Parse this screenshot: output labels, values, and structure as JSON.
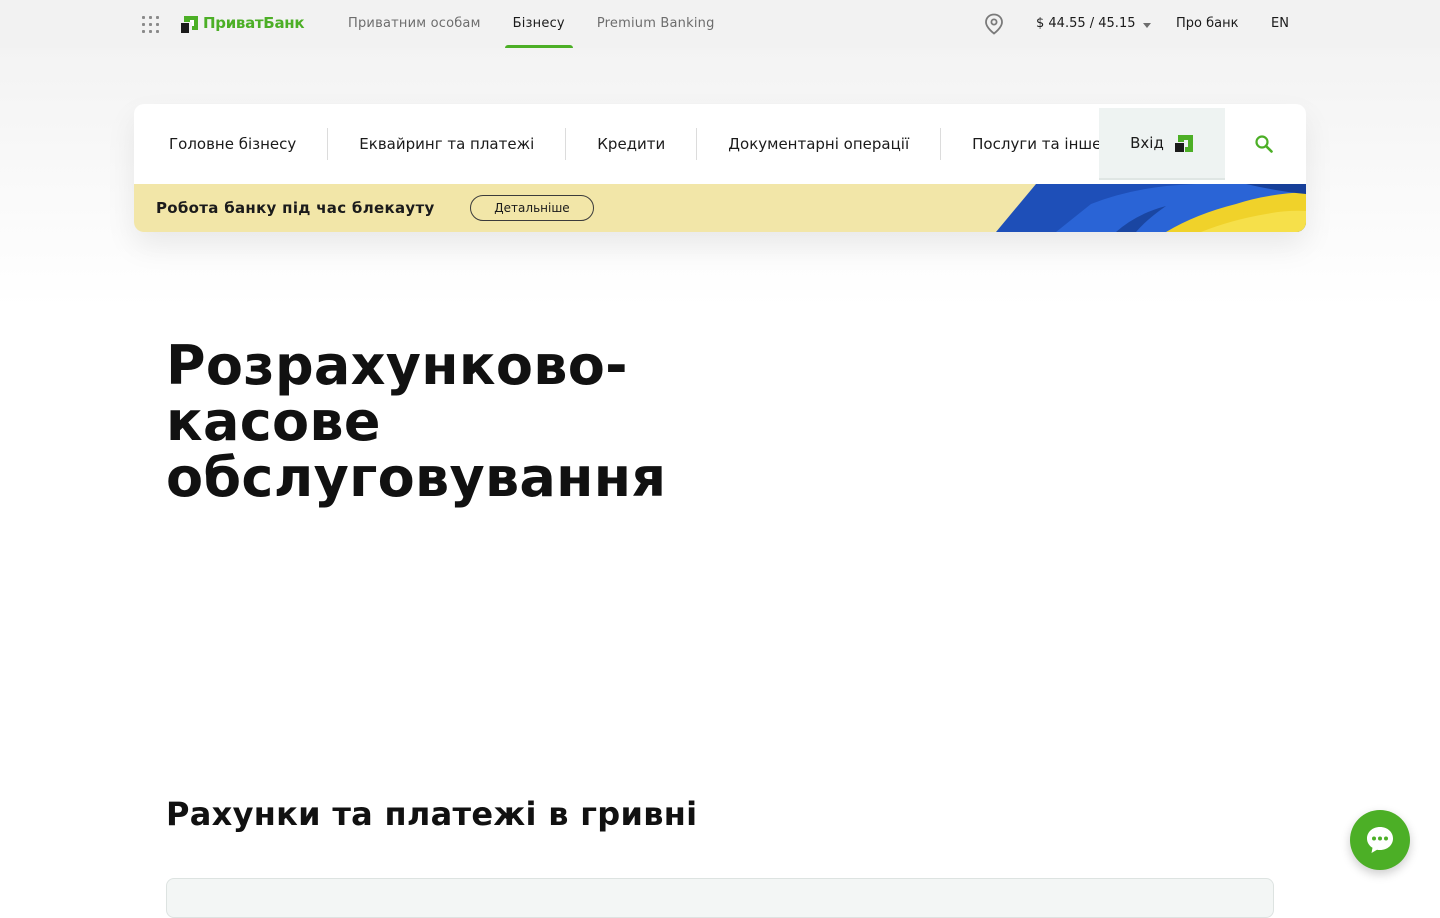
{
  "topbar": {
    "logo_text": "ПриватБанк",
    "nav": [
      {
        "label": "Приватним особам",
        "active": false
      },
      {
        "label": "Бізнесу",
        "active": true
      },
      {
        "label": "Premium Banking",
        "active": false
      }
    ],
    "rate": "$ 44.55 / 45.15",
    "about": "Про банк",
    "lang": "EN",
    "icons": {
      "apps": "apps-grid-icon",
      "location": "location-pin-icon",
      "rate_dropdown": "chevron-down-icon"
    }
  },
  "mainnav": {
    "items": [
      "Головне бізнесу",
      "Еквайринг та платежі",
      "Кредити",
      "Документарні операції",
      "Послуги та інше"
    ],
    "login_label": "Вхід",
    "icons": {
      "login": "privat-logo-icon",
      "search": "search-icon"
    }
  },
  "banner": {
    "text": "Робота банку під час блекауту",
    "button": "Детальніше"
  },
  "hero": {
    "title_lines": [
      "Розрахунково-",
      "касове",
      "обслуговування"
    ]
  },
  "section": {
    "title": "Рахунки та платежі в гривні"
  },
  "chat": {
    "icon": "chat-bubble-icon"
  },
  "colors": {
    "brand_green": "#4caf26",
    "banner_yellow": "#f2e6a8",
    "flag_blue": "#1e4fb8",
    "flag_yellow": "#f0d22a"
  }
}
